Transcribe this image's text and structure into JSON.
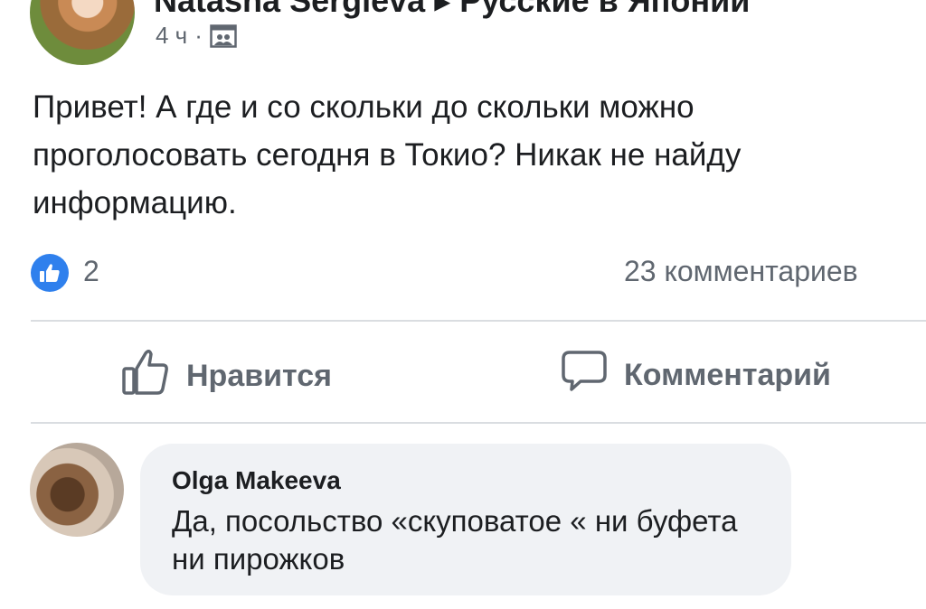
{
  "post": {
    "author": "Natasha Sergieva",
    "group": "Русские в Японии",
    "time": "4 ч",
    "separator": "·",
    "text": "Привет! А где и со скольки до скольки можно проголосовать сегодня в Токио? Никак не найду информацию."
  },
  "stats": {
    "likes": "2",
    "comments": "23 комментариев"
  },
  "actions": {
    "like_label": "Нравится",
    "comment_label": "Комментарий"
  },
  "comment": {
    "author": "Olga Makeeva",
    "text": "Да, посольство «скуповатое « ни буфета ни пирожков"
  },
  "colors": {
    "like_blue": "#2f80ed",
    "secondary_text": "#606770",
    "bubble_bg": "#f0f2f5"
  },
  "icons": [
    "privacy-group-icon",
    "like-reaction-icon",
    "thumbs-up-icon",
    "comment-icon"
  ]
}
